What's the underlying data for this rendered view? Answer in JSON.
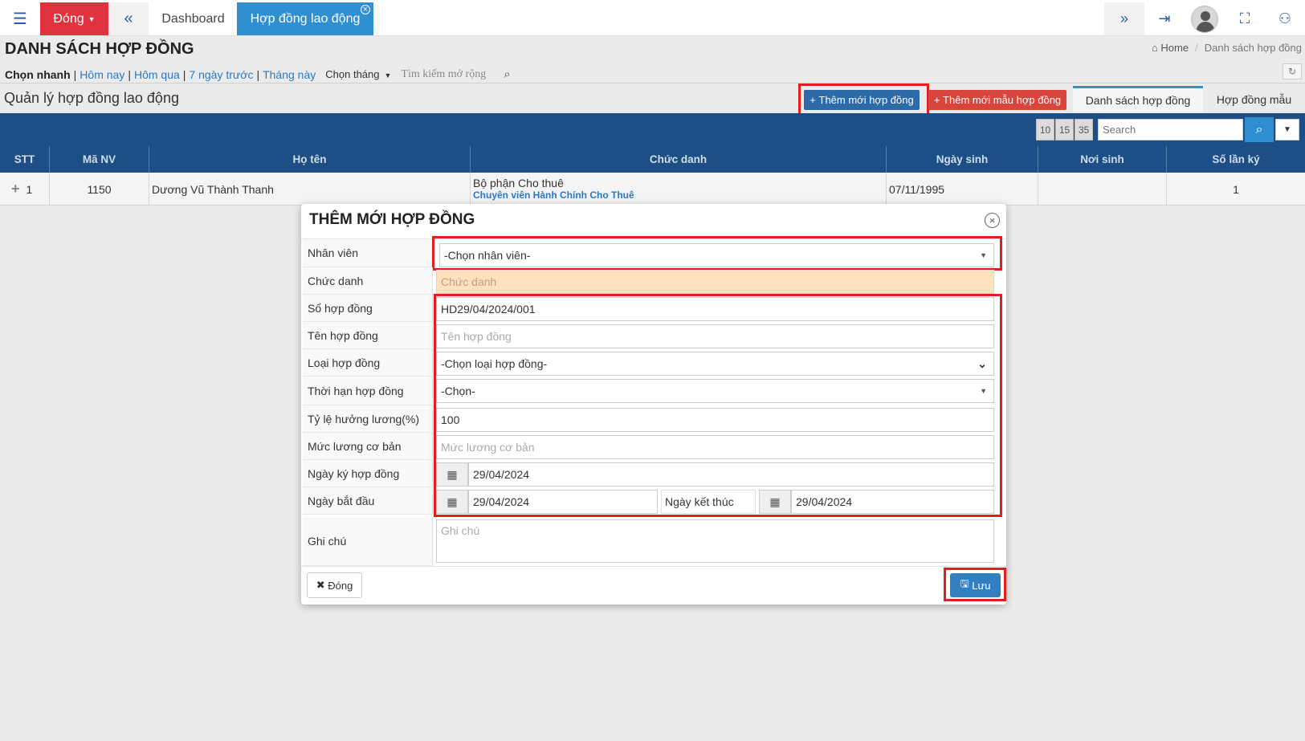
{
  "topbar": {
    "close_label": "Đóng",
    "tabs": [
      "Dashboard",
      "Hợp đồng lao động"
    ]
  },
  "page": {
    "title": "DANH SÁCH HỢP ĐỒNG",
    "breadcrumb": [
      "Home",
      "Danh sách hợp đồng"
    ]
  },
  "quick_filter": {
    "label": "Chọn nhanh",
    "links": [
      "Hôm nay",
      "Hôm qua",
      "7 ngày trước",
      "Tháng này"
    ],
    "month_label": "Chọn tháng",
    "extended_search": "Tìm kiếm mở rộng"
  },
  "section": {
    "subtitle": "Quản lý hợp đồng lao động",
    "add_button": "Thêm mới hợp đồng",
    "add_template_button": "Thêm mới mẫu hợp đồng",
    "tabs": [
      "Danh sách hợp đồng",
      "Hợp đồng mẫu"
    ]
  },
  "table": {
    "page_sizes": [
      "10",
      "15",
      "35"
    ],
    "search_placeholder": "Search",
    "columns": [
      "STT",
      "Mã NV",
      "Họ tên",
      "Chức danh",
      "Ngày sinh",
      "Nơi sinh",
      "Số lần ký"
    ],
    "rows": [
      {
        "stt": "1",
        "ma_nv": "1150",
        "ho_ten": "Dương Vũ Thành Thanh",
        "bo_phan": "Bộ phận Cho thuê",
        "chuc_danh": "Chuyên viên Hành Chính Cho Thuê",
        "ngay_sinh": "07/11/1995",
        "noi_sinh": "",
        "so_lan_ky": "1"
      }
    ]
  },
  "modal": {
    "title": "THÊM MỚI HỢP ĐỒNG",
    "labels": {
      "nhan_vien": "Nhân viên",
      "chuc_danh": "Chức danh",
      "so_hop_dong": "Số hợp đồng",
      "ten_hop_dong": "Tên hợp đồng",
      "loai_hop_dong": "Loại hợp đồng",
      "thoi_han": "Thời hạn hợp đồng",
      "ty_le_luong": "Tỷ lệ hưởng lương(%)",
      "muc_luong": "Mức lương cơ bản",
      "ngay_ky": "Ngày ký hợp đồng",
      "ngay_bat_dau": "Ngày bắt đầu",
      "ngay_ket_thuc": "Ngày kết thúc",
      "ghi_chu": "Ghi chú"
    },
    "values": {
      "nhan_vien": "-Chọn nhân viên-",
      "chuc_danh_placeholder": "Chức danh",
      "so_hop_dong": "HD29/04/2024/001",
      "ten_hop_dong_placeholder": "Tên hợp đồng",
      "loai_hop_dong": "-Chọn loại hợp đồng-",
      "thoi_han": "-Chọn-",
      "ty_le_luong": "100",
      "muc_luong_placeholder": "Mức lương cơ bản",
      "ngay_ky": "29/04/2024",
      "ngay_bat_dau": "29/04/2024",
      "ngay_ket_thuc": "29/04/2024",
      "ghi_chu_placeholder": "Ghi chú"
    },
    "close_button": "Đóng",
    "save_button": "Lưu"
  },
  "colors": {
    "header_blue": "#1d4f86",
    "accent_blue": "#2f8fd0",
    "danger_red": "#e0323f",
    "highlight_red": "#e02020",
    "readonly_orange": "#ffe1bd"
  }
}
